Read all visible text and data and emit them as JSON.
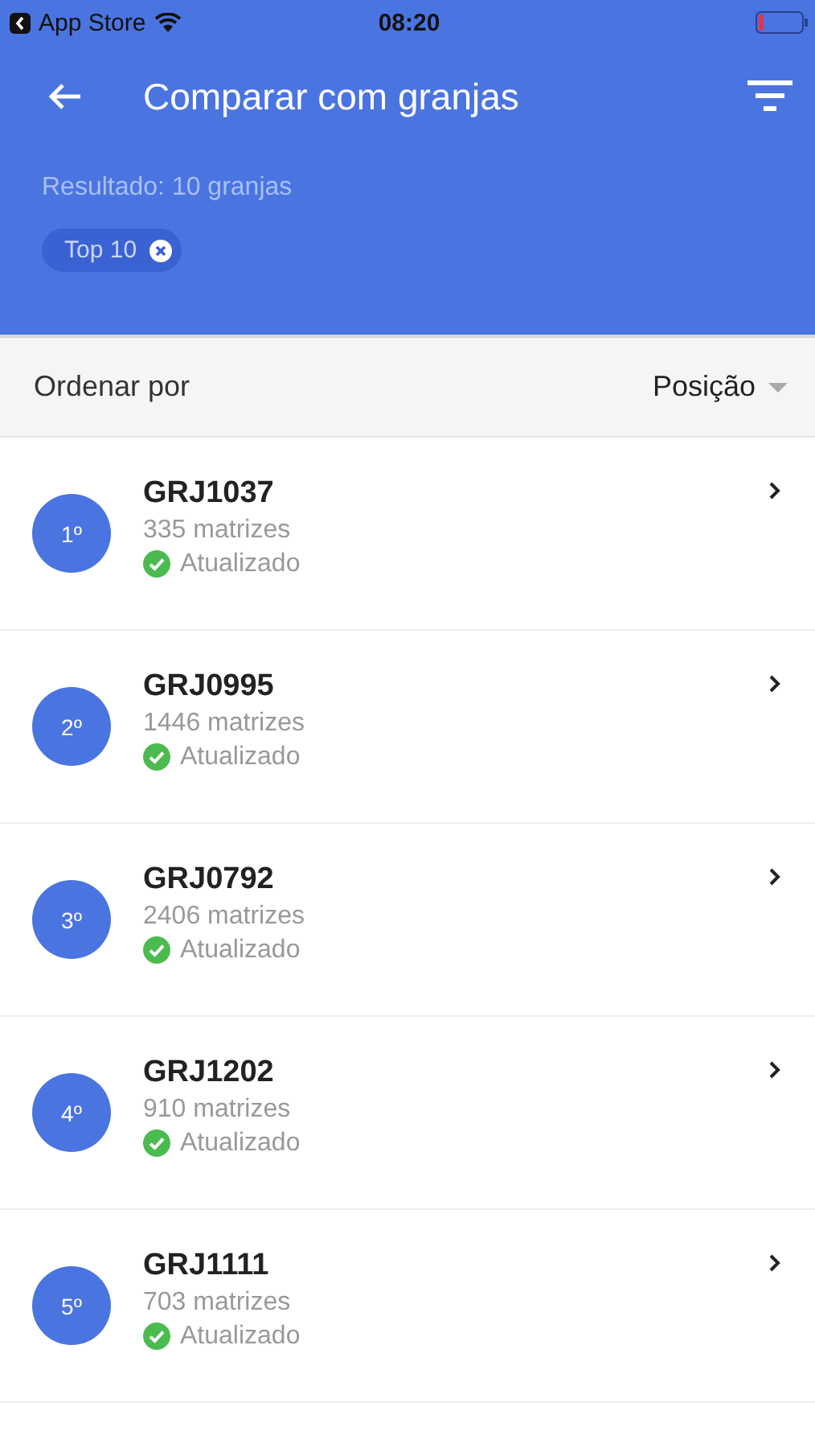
{
  "status_bar": {
    "back_label": "App Store",
    "time": "08:20"
  },
  "header": {
    "title": "Comparar com granjas",
    "result": "Resultado: 10 granjas",
    "chips": [
      {
        "label": "Top 10"
      }
    ]
  },
  "sort": {
    "label": "Ordenar por",
    "value": "Posição"
  },
  "farms": [
    {
      "rank": "1º",
      "code": "GRJ1037",
      "sows": "335 matrizes",
      "status": "Atualizado",
      "updated": true
    },
    {
      "rank": "2º",
      "code": "GRJ0995",
      "sows": "1446 matrizes",
      "status": "Atualizado",
      "updated": true
    },
    {
      "rank": "3º",
      "code": "GRJ0792",
      "sows": "2406 matrizes",
      "status": "Atualizado",
      "updated": true
    },
    {
      "rank": "4º",
      "code": "GRJ1202",
      "sows": "910 matrizes",
      "status": "Atualizado",
      "updated": true
    },
    {
      "rank": "5º",
      "code": "GRJ1111",
      "sows": "703 matrizes",
      "status": "Atualizado",
      "updated": true
    }
  ]
}
